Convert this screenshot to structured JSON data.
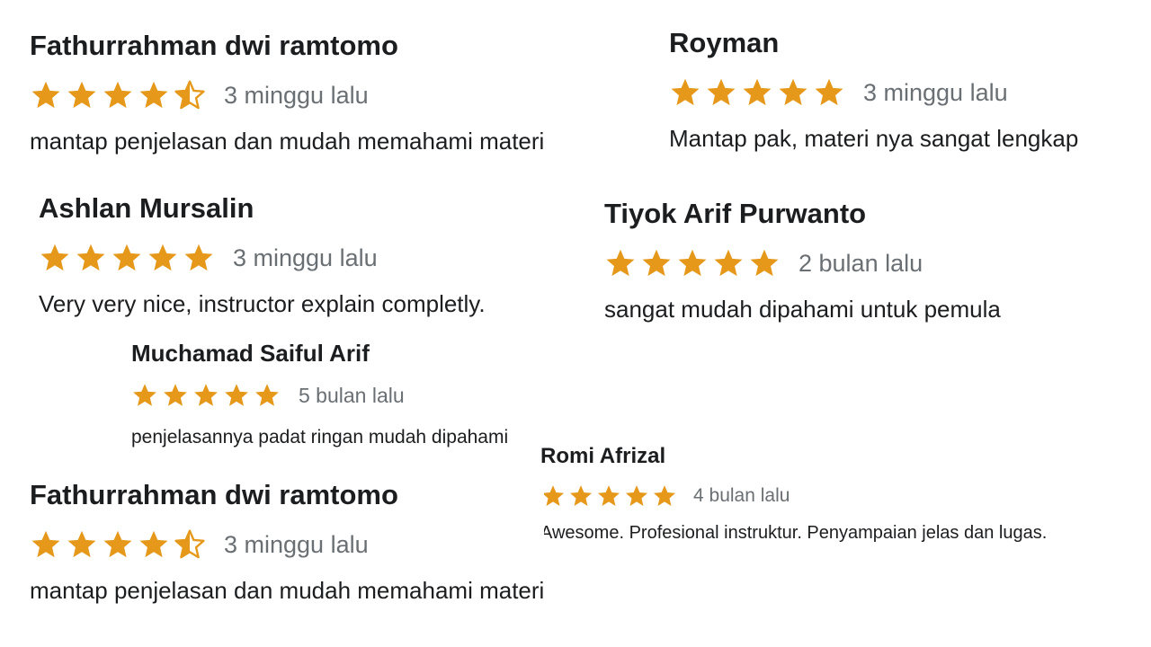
{
  "colors": {
    "star": "#e59819",
    "name": "#1c1d1f",
    "time": "#6a6f73",
    "comment": "#1c1d1f"
  },
  "reviews": [
    {
      "name": "Fathurrahman dwi ramtomo",
      "rating": 4.5,
      "time": "3 minggu lalu",
      "comment": "mantap penjelasan dan mudah memahami materi"
    },
    {
      "name": "Royman",
      "rating": 5,
      "time": "3 minggu lalu",
      "comment": "Mantap pak, materi nya sangat lengkap"
    },
    {
      "name": "Ashlan Mursalin",
      "rating": 5,
      "time": "3 minggu lalu",
      "comment": "Very very nice, instructor explain completly."
    },
    {
      "name": "Tiyok Arif Purwanto",
      "rating": 5,
      "time": "2 bulan lalu",
      "comment": "sangat mudah dipahami untuk pemula"
    },
    {
      "name": "Muchamad Saiful Arif",
      "rating": 5,
      "time": "5 bulan lalu",
      "comment": "penjelasannya padat ringan mudah dipahami"
    },
    {
      "name": "Romi Afrizal",
      "rating": 5,
      "time": "4 bulan lalu",
      "comment": "Awesome. Profesional instruktur. Penyampaian jelas dan lugas."
    },
    {
      "name": "Fathurrahman dwi ramtomo",
      "rating": 4.5,
      "time": "3 minggu lalu",
      "comment": "mantap penjelasan dan mudah memahami materi"
    }
  ]
}
